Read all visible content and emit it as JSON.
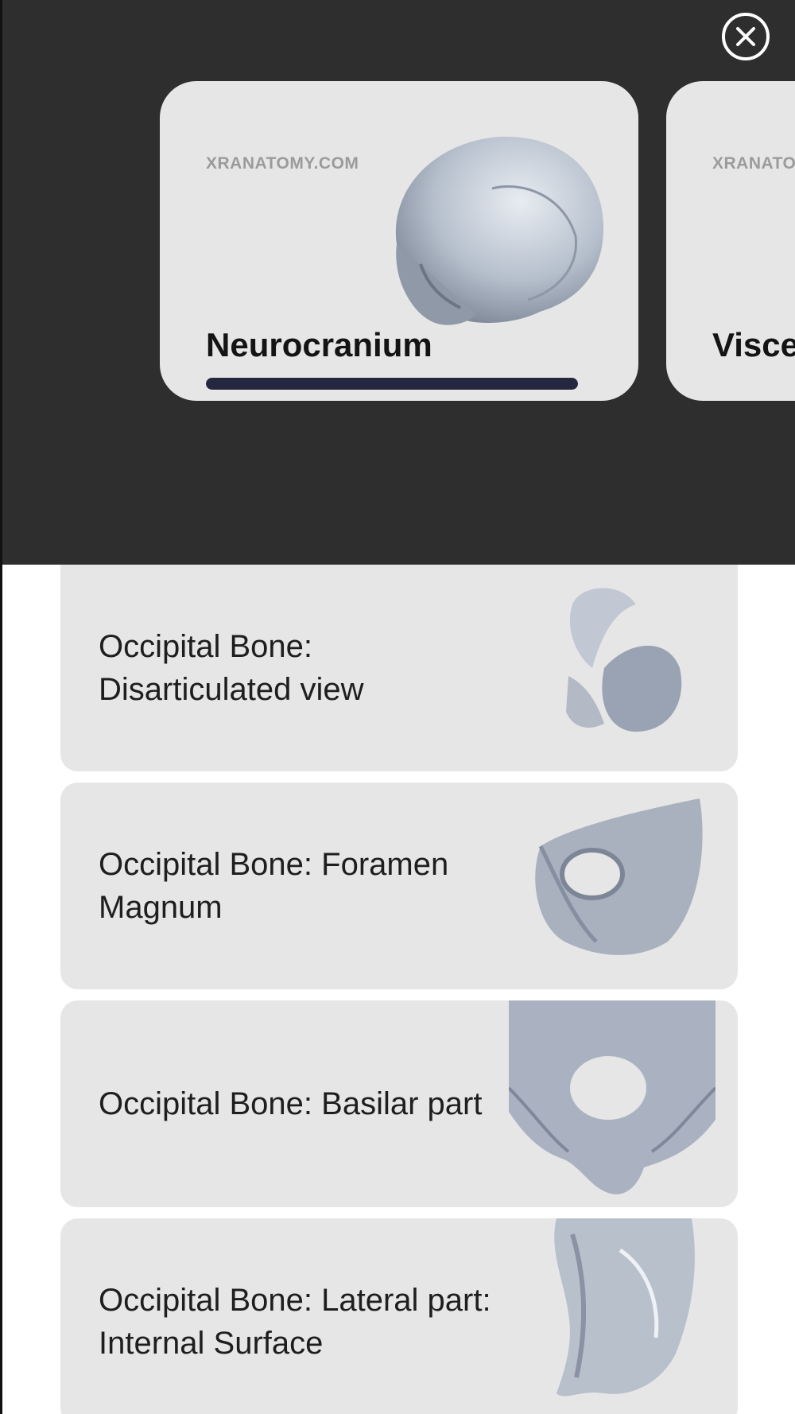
{
  "header": {
    "close_icon": "close-circle-icon"
  },
  "carousel": {
    "cards": [
      {
        "brand": "XRANATOMY.COM",
        "title": "Neurocranium",
        "progress": 1.0
      },
      {
        "brand": "XRANATO",
        "title": "Visce"
      }
    ]
  },
  "list": {
    "items": [
      {
        "label": "Occipital Bone: Disarticulated view"
      },
      {
        "label": "Occipital Bone: Foramen Magnum"
      },
      {
        "label": "Occipital Bone: Basilar part"
      },
      {
        "label": "Occipital Bone:  Lateral part: Internal Surface"
      }
    ]
  },
  "colors": {
    "header_bg": "#2e2e2e",
    "card_bg": "#e6e6e6",
    "progress_fill": "#24273d",
    "bone": "#c9ced8"
  }
}
